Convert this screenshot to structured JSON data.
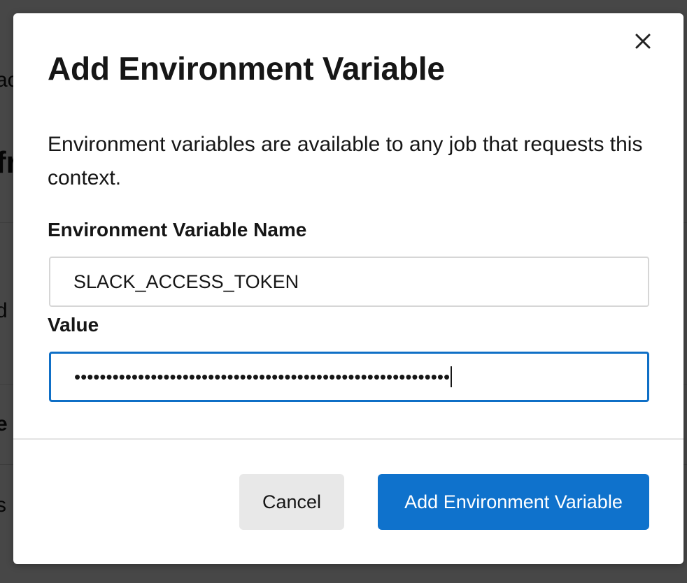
{
  "background_fragments": [
    "ac",
    "fr",
    "d",
    "e",
    "s"
  ],
  "modal": {
    "title": "Add Environment Variable",
    "description": "Environment variables are available to any job that requests this context.",
    "name_field": {
      "label": "Environment Variable Name",
      "value": "SLACK_ACCESS_TOKEN"
    },
    "value_field": {
      "label": "Value",
      "masked_value": "•••••••••••••••••••••••••••••••••••••••••••••••••••••••••••"
    },
    "buttons": {
      "cancel": "Cancel",
      "submit": "Add Environment Variable"
    },
    "close_icon": "close-icon"
  },
  "colors": {
    "primary": "#0f72cc",
    "focus_border": "#0f6fc6",
    "cancel_bg": "#e8e8e8",
    "overlay": "#4a4a4a"
  }
}
